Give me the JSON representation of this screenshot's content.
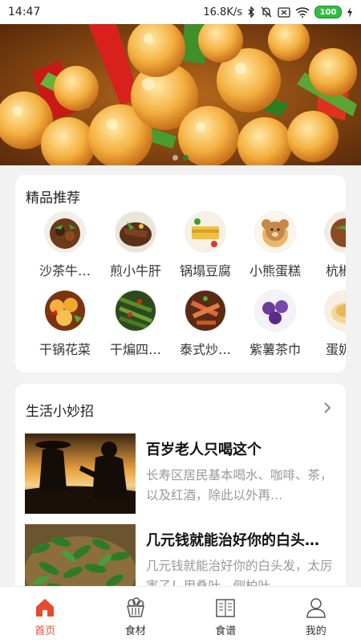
{
  "status_bar": {
    "time": "14:47",
    "net_speed": "16.8K/s",
    "battery": "100"
  },
  "banner": {
    "slides": 2,
    "active": 1
  },
  "featured": {
    "title": "精品推荐",
    "row1": [
      "沙茶牛…",
      "煎小牛肝",
      "锅塌豆腐",
      "小熊蛋糕",
      "杭椒…"
    ],
    "row2": [
      "干锅花菜",
      "干煸四…",
      "泰式炒…",
      "紫薯茶巾",
      "蛋奶…"
    ]
  },
  "tips": {
    "title": "生活小妙招",
    "articles": [
      {
        "title": "百岁老人只喝这个",
        "desc": "长寿区居民基本喝水、咖啡、茶，以及红酒，除此以外再…"
      },
      {
        "title": "几元钱就能治好你的白头…",
        "desc": "几元钱就能治好你的白头发，太厉害了！用桑叶、侧柏叶…"
      }
    ]
  },
  "nav": {
    "items": [
      {
        "label": "首页",
        "icon": "home-icon",
        "active": true
      },
      {
        "label": "食材",
        "icon": "basket-icon",
        "active": false
      },
      {
        "label": "食谱",
        "icon": "recipe-book-icon",
        "active": false
      },
      {
        "label": "我的",
        "icon": "user-icon",
        "active": false
      }
    ]
  },
  "colors": {
    "accent": "#e84a2c",
    "background": "#f2f2f2"
  }
}
